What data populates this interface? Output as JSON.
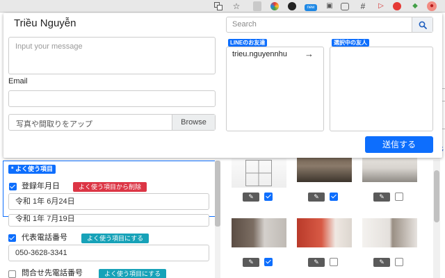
{
  "browser_toolbar": {
    "extensions": [
      "translate-icon",
      "star-icon",
      "extension-icon-1",
      "extension-icon-2",
      "extension-icon-3",
      "new-badge-extension-icon",
      "extension-icon-5",
      "extension-icon-6",
      "hash-icon",
      "extension-icon-8",
      "extension-icon-9",
      "extension-icon-10",
      "profile-extension-icon"
    ],
    "new_badge": "new"
  },
  "popup": {
    "user_name": "Triều Nguyễn",
    "message_placeholder": "Input your message",
    "email_label": "Email",
    "email_value": "",
    "upload_placeholder": "写真や間取りをアップ",
    "browse_label": "Browse",
    "search_placeholder": "Search",
    "line_friends_header": "LINEのお友達",
    "selected_friends_header": "選択中の友人",
    "friends": [
      {
        "name": "trieu.nguyennhu"
      }
    ],
    "selected_friends": [],
    "move_arrow": "→",
    "send_label": "送信する",
    "accent_color": "#0d6efd"
  },
  "form": {
    "favorites_header": "* よく使う項目",
    "fields": [
      {
        "label": "登録年月日",
        "checked": true,
        "tag": "よく使う項目から削除",
        "tag_color": "#dc3545",
        "value": "令和 1年 6月24日"
      },
      {
        "label": "",
        "checked": null,
        "tag": "",
        "value": "令和 1年 7月19日"
      },
      {
        "label": "代表電話番号",
        "checked": true,
        "tag": "よく使う項目にする",
        "tag_color": "#17a2b8",
        "value": "050-3628-3341"
      },
      {
        "label": "問合せ先電話番号",
        "checked": false,
        "tag": "よく使う項目にする",
        "tag_color": "#17a2b8",
        "value": ""
      }
    ]
  },
  "photos": [
    {
      "kind": "floor plan",
      "checked": true
    },
    {
      "kind": "house exterior",
      "checked": true
    },
    {
      "kind": "empty room",
      "checked": false
    },
    {
      "kind": "kitchen",
      "checked": true
    },
    {
      "kind": "red door room",
      "checked": false
    },
    {
      "kind": "closet",
      "checked": false
    }
  ],
  "edit_icon": "pencil-icon",
  "page_edge_text": "移"
}
